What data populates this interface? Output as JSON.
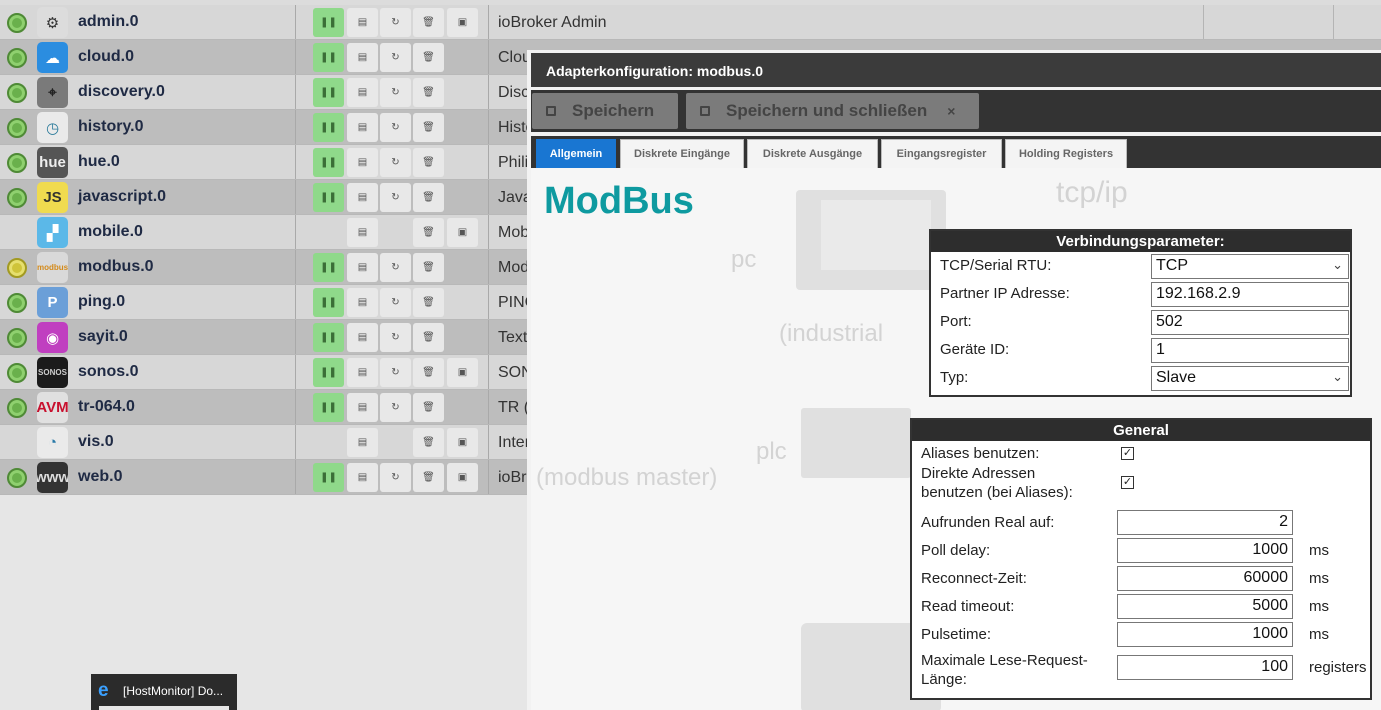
{
  "adapters": [
    {
      "name": "admin.0",
      "desc": "ioBroker Admin",
      "status": "green",
      "icon": {
        "label": "⚙",
        "bg": "#dcdcdc",
        "fg": "#333"
      },
      "img": true,
      "running": true
    },
    {
      "name": "cloud.0",
      "desc": "Clou",
      "status": "green",
      "icon": {
        "label": "☁",
        "bg": "#2b8de0",
        "fg": "#fff"
      },
      "img": false,
      "running": true
    },
    {
      "name": "discovery.0",
      "desc": "Disc",
      "status": "green",
      "icon": {
        "label": "⌖",
        "bg": "#7a7a7a",
        "fg": "#222"
      },
      "img": false,
      "running": true
    },
    {
      "name": "history.0",
      "desc": "Histo",
      "status": "green",
      "icon": {
        "label": "◷",
        "bg": "#eaeaea",
        "fg": "#2a7a9a"
      },
      "img": false,
      "running": true
    },
    {
      "name": "hue.0",
      "desc": "Phili",
      "status": "green",
      "icon": {
        "label": "hue",
        "bg": "#555",
        "fg": "#eee"
      },
      "img": false,
      "running": true
    },
    {
      "name": "javascript.0",
      "desc": "Java",
      "status": "green",
      "icon": {
        "label": "JS",
        "bg": "#f0db4f",
        "fg": "#323330"
      },
      "img": false,
      "running": true
    },
    {
      "name": "mobile.0",
      "desc": "Mob",
      "status": "none",
      "icon": {
        "label": "▞",
        "bg": "#5bb8e8",
        "fg": "#fff"
      },
      "img": true,
      "running": false
    },
    {
      "name": "modbus.0",
      "desc": "Mod",
      "status": "yellow",
      "icon": {
        "label": "modbus",
        "bg": "#d9d9d9",
        "fg": "#d48a1a"
      },
      "img": false,
      "running": true
    },
    {
      "name": "ping.0",
      "desc": "PING",
      "status": "green",
      "icon": {
        "label": "P",
        "bg": "#6b9fd8",
        "fg": "#fff"
      },
      "img": false,
      "running": true
    },
    {
      "name": "sayit.0",
      "desc": "Text",
      "status": "green",
      "icon": {
        "label": "◉",
        "bg": "#c03fc0",
        "fg": "#fff"
      },
      "img": false,
      "running": true
    },
    {
      "name": "sonos.0",
      "desc": "SON",
      "status": "green",
      "icon": {
        "label": "SONOS",
        "bg": "#1b1b1b",
        "fg": "#ccc"
      },
      "img": true,
      "running": true
    },
    {
      "name": "tr-064.0",
      "desc": "TR (",
      "status": "green",
      "icon": {
        "label": "AVM",
        "bg": "#e0e0e0",
        "fg": "#c8102e"
      },
      "img": false,
      "running": true
    },
    {
      "name": "vis.0",
      "desc": "Inter",
      "status": "none",
      "icon": {
        "label": "◔",
        "bg": "#eaeaea",
        "fg": "#2a7aa8"
      },
      "img": true,
      "running": false
    },
    {
      "name": "web.0",
      "desc": "ioBr",
      "status": "green",
      "icon": {
        "label": "www",
        "bg": "#333",
        "fg": "#ddd"
      },
      "img": true,
      "running": true
    }
  ],
  "taskbar": {
    "title": "[HostMonitor] Do..."
  },
  "dialog": {
    "title": "Adapterkonfiguration: modbus.0",
    "save_label": "Speichern",
    "save_close_label": "Speichern und schließen",
    "close_glyph": "×",
    "tabs": [
      "Allgemein",
      "Diskrete Eingänge",
      "Diskrete Ausgänge",
      "Eingangsregister",
      "Holding Registers"
    ],
    "heading": "ModBus",
    "background_words": {
      "tcpip": "tcp/ip",
      "pc": "pc",
      "industrial": "(industrial",
      "plc": "plc",
      "master": "(modbus master)"
    },
    "connection": {
      "header": "Verbindungsparameter:",
      "rows": [
        {
          "label": "TCP/Serial RTU:",
          "value": "TCP",
          "select": true
        },
        {
          "label": "Partner IP Adresse:",
          "value": "192.168.2.9",
          "select": false
        },
        {
          "label": "Port:",
          "value": "502",
          "select": false
        },
        {
          "label": "Geräte ID:",
          "value": "1",
          "select": false
        },
        {
          "label": "Typ:",
          "value": "Slave",
          "select": true
        }
      ]
    },
    "general": {
      "header": "General",
      "aliases_label": "Aliases benutzen:",
      "aliases_checked": true,
      "direct_label_1": "Direkte Adressen",
      "direct_label_2": "benutzen (bei Aliases):",
      "direct_checked": true,
      "rows": [
        {
          "label": "Aufrunden Real auf:",
          "value": "2",
          "unit": ""
        },
        {
          "label": "Poll delay:",
          "value": "1000",
          "unit": "ms"
        },
        {
          "label": "Reconnect-Zeit:",
          "value": "60000",
          "unit": "ms"
        },
        {
          "label": "Read timeout:",
          "value": "5000",
          "unit": "ms"
        },
        {
          "label": "Pulsetime:",
          "value": "1000",
          "unit": "ms"
        }
      ],
      "maxreq_label_1": "Maximale Lese-Request-",
      "maxreq_label_2": "Länge:",
      "maxreq_value": "100",
      "maxreq_unit": "registers"
    }
  }
}
